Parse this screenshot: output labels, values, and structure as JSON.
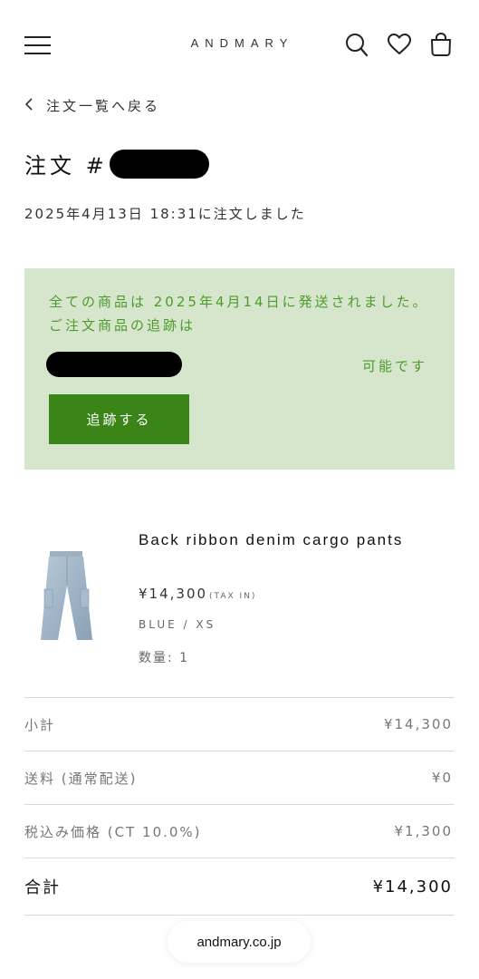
{
  "header": {
    "logo": "ANDMARY",
    "menu_icon": "hamburger-menu-icon",
    "search_icon": "search-icon",
    "wishlist_icon": "heart-icon",
    "cart_icon": "bag-icon"
  },
  "back_link": {
    "label": "注文一覧へ戻る",
    "icon": "chevron-left-icon"
  },
  "order": {
    "title_prefix": "注文 #",
    "date_text": "2025年4月13日 18:31に注文しました"
  },
  "shipping": {
    "message": "全ての商品は 2025年4月14日に発送されました。 ご注文商品の追跡は",
    "availability": "可能です",
    "track_button": "追跡する",
    "colors": {
      "bg": "#d5e6cc",
      "text": "#4f9a2e",
      "button": "#3b8518"
    }
  },
  "product": {
    "name": "Back ribbon denim cargo pants",
    "price": "¥14,300",
    "tax_label": "(TAX IN)",
    "variant": "BLUE / XS",
    "quantity_label": "数量: 1"
  },
  "summary": {
    "rows": [
      {
        "label": "小計",
        "value": "¥14,300"
      },
      {
        "label": "送料 (通常配送)",
        "value": "¥0"
      },
      {
        "label": "税込み価格 (CT 10.0%)",
        "value": "¥1,300"
      }
    ],
    "total": {
      "label": "合計",
      "value": "¥14,300"
    }
  },
  "browser": {
    "url": "andmary.co.jp"
  }
}
